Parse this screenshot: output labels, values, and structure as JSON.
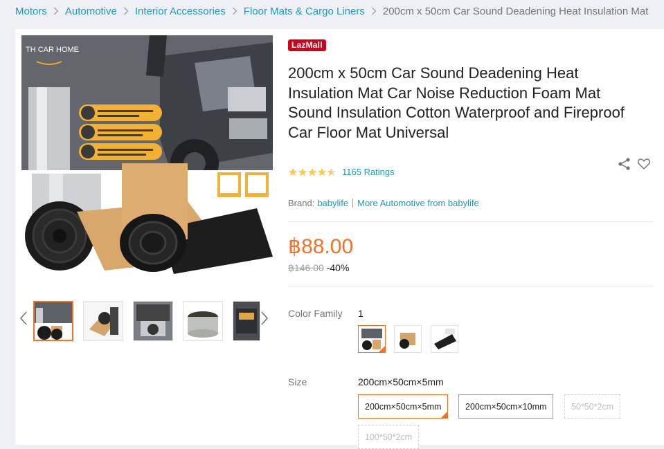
{
  "breadcrumb": {
    "items": [
      "Motors",
      "Automotive",
      "Interior Accessories",
      "Floor Mats & Cargo Liners"
    ],
    "current": "200cm x 50cm Car Sound Deadening Heat Insulation Mat"
  },
  "gallery": {
    "brand_watermark": "TH CAR HOME",
    "thumbnail_count": 5
  },
  "product": {
    "badge": "LazMall",
    "title": "200cm x 50cm Car Sound Deadening Heat Insulation Mat Car Noise Reduction Foam Mat Sound Insulation Cotton Waterproof and Fireproof Car Floor Mat Universal",
    "rating_stars": 4.5,
    "ratings_label": "1165 Ratings",
    "brand_label": "Brand:",
    "brand_name": "babylife",
    "more_from": "More Automotive from babylife",
    "price": "฿88.00",
    "old_price": "฿146.00",
    "discount": "-40%"
  },
  "variants": {
    "color_label": "Color Family",
    "color_value": "1",
    "size_label": "Size",
    "size_value": "200cm×50cm×5mm",
    "sizes": [
      {
        "label": "200cm×50cm×5mm",
        "state": "selected"
      },
      {
        "label": "200cm×50cm×10mm",
        "state": "available"
      },
      {
        "label": "50*50*2cm",
        "state": "disabled"
      },
      {
        "label": "100*50*2cm",
        "state": "disabled"
      }
    ]
  },
  "colors": {
    "accent": "#f57224",
    "link": "#1a9cb7",
    "lazmall": "#d0021b",
    "star": "#faca51"
  }
}
